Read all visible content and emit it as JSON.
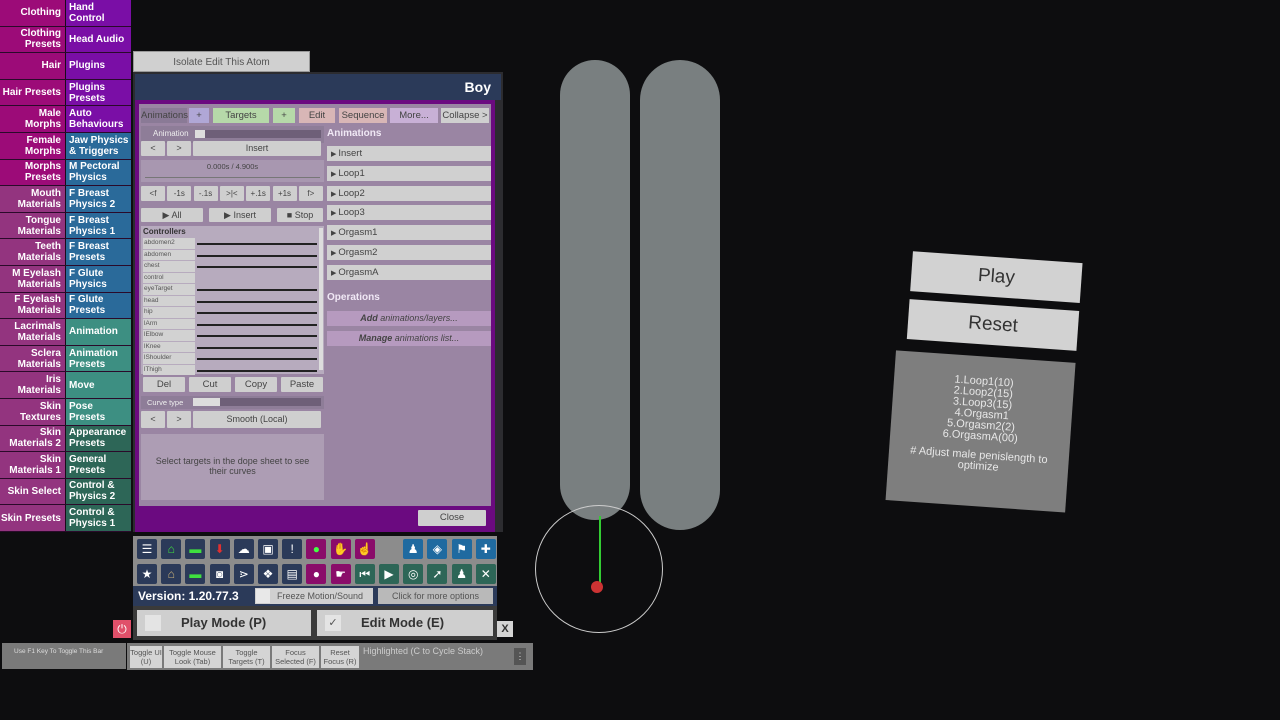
{
  "left_menu": [
    {
      "left": "Clothing",
      "right": "Hand Control",
      "lcolor": "#9c0b78",
      "rcolor": "#7a0ea6"
    },
    {
      "left": "Clothing Presets",
      "right": "Head Audio",
      "lcolor": "#9c0b78",
      "rcolor": "#7a0ea6"
    },
    {
      "left": "Hair",
      "right": "Plugins",
      "lcolor": "#9c0b78",
      "rcolor": "#7a0ea6"
    },
    {
      "left": "Hair Presets",
      "right": "Plugins Presets",
      "lcolor": "#9c0b78",
      "rcolor": "#7a0ea6"
    },
    {
      "left": "Male Morphs",
      "right": "Auto Behaviours",
      "lcolor": "#9c0b78",
      "rcolor": "#7a0ea6"
    },
    {
      "left": "Female Morphs",
      "right": "Jaw Physics & Triggers",
      "lcolor": "#9c0b78",
      "rcolor": "#2a6a9a"
    },
    {
      "left": "Morphs Presets",
      "right": "M Pectoral Physics",
      "lcolor": "#9c0b78",
      "rcolor": "#2a6a9a"
    },
    {
      "left": "Mouth Materials",
      "right": "F Breast Physics 2",
      "lcolor": "#93347f",
      "rcolor": "#2a6a9a"
    },
    {
      "left": "Tongue Materials",
      "right": "F Breast Physics 1",
      "lcolor": "#93347f",
      "rcolor": "#2a6a9a"
    },
    {
      "left": "Teeth Materials",
      "right": "F Breast Presets",
      "lcolor": "#93347f",
      "rcolor": "#2a6a9a"
    },
    {
      "left": "M Eyelash Materials",
      "right": "F Glute Physics",
      "lcolor": "#93347f",
      "rcolor": "#2a6a9a"
    },
    {
      "left": "F Eyelash Materials",
      "right": "F Glute Presets",
      "lcolor": "#93347f",
      "rcolor": "#2a6a9a"
    },
    {
      "left": "Lacrimals Materials",
      "right": "Animation",
      "lcolor": "#93347f",
      "rcolor": "#3d8f82"
    },
    {
      "left": "Sclera Materials",
      "right": "Animation Presets",
      "lcolor": "#93347f",
      "rcolor": "#3d8f82"
    },
    {
      "left": "Iris Materials",
      "right": "Move",
      "lcolor": "#93347f",
      "rcolor": "#3d8f82"
    },
    {
      "left": "Skin Textures",
      "right": "Pose Presets",
      "lcolor": "#93347f",
      "rcolor": "#3d8f82"
    },
    {
      "left": "Skin Materials 2",
      "right": "Appearance Presets",
      "lcolor": "#93347f",
      "rcolor": "#2d6657"
    },
    {
      "left": "Skin Materials 1",
      "right": "General Presets",
      "lcolor": "#93347f",
      "rcolor": "#2d6657"
    },
    {
      "left": "Skin Select",
      "right": "Control & Physics 2",
      "lcolor": "#93347f",
      "rcolor": "#2d6657"
    },
    {
      "left": "Skin Presets",
      "right": "Control & Physics 1",
      "lcolor": "#93347f",
      "rcolor": "#2d6657"
    }
  ],
  "isolate_button": "Isolate Edit This Atom",
  "panel": {
    "title": "Boy",
    "tabs": [
      {
        "label": "Animations",
        "color": "#8a7a96"
      },
      {
        "label": "+",
        "color": "#b0a7d6"
      },
      {
        "label": "Targets",
        "color": "#b6d9a9"
      },
      {
        "label": "+",
        "color": "#b6d9a9"
      },
      {
        "label": "Edit",
        "color": "#d8b6b6"
      },
      {
        "label": "Sequence",
        "color": "#d8b6b6"
      },
      {
        "label": "More...",
        "color": "#c8b0d6"
      },
      {
        "label": "Collapse >",
        "color": "#cfcfcf"
      }
    ],
    "animation_label": "Animation",
    "prev_btn": "<",
    "next_btn": ">",
    "insert_btn": "Insert",
    "time_display": "0.000s / 4.900s",
    "scrub_buttons": [
      "<f",
      "-1s",
      "-.1s",
      ">|<",
      "+.1s",
      "+1s",
      "f>"
    ],
    "play_all": "▶ All",
    "play_insert": "▶ Insert",
    "stop": "■ Stop",
    "controllers_header": "Controllers",
    "controllers": [
      "abdomen2",
      "abdomen",
      "chest",
      "control",
      "eyeTarget",
      "head",
      "hip",
      "lArm",
      "lElbow",
      "lKnee",
      "lShoulder",
      "lThigh"
    ],
    "edit_buttons": [
      "Del",
      "Cut",
      "Copy",
      "Paste"
    ],
    "curve_type_label": "Curve type",
    "curve_type_value": "Smooth (Local)",
    "curve_hint": "Select targets in the dope sheet to see their curves",
    "animations_header": "Animations",
    "animations": [
      "Insert",
      "Loop1",
      "Loop2",
      "Loop3",
      "Orgasm1",
      "Orgasm2",
      "OrgasmA"
    ],
    "operations_header": "Operations",
    "op_add": {
      "bold": "Add",
      "rest": " animations/layers..."
    },
    "op_manage": {
      "bold": "Manage",
      "rest": " animations list..."
    },
    "close_btn": "Close"
  },
  "toolbar": {
    "row1": [
      {
        "name": "menu-icon",
        "glyph": "☰",
        "color": "#2b3a59",
        "fg": "#fff"
      },
      {
        "name": "open-scene-icon",
        "glyph": "⌂",
        "color": "#2b3a59",
        "fg": "#3fe03f"
      },
      {
        "name": "folder-icon",
        "glyph": "▬",
        "color": "#2b3a59",
        "fg": "#3fe03f"
      },
      {
        "name": "save-icon",
        "glyph": "⬇",
        "color": "#2b3a59",
        "fg": "#e03030"
      },
      {
        "name": "cloud-icon",
        "glyph": "☁",
        "color": "#2b3a59",
        "fg": "#fff"
      },
      {
        "name": "package-icon",
        "glyph": "▣",
        "color": "#2b3a59",
        "fg": "#fff"
      },
      {
        "name": "alert-icon",
        "glyph": "!",
        "color": "#2b3a59",
        "fg": "#fff"
      },
      {
        "name": "add-person-icon",
        "glyph": "●",
        "color": "#8a0c6a",
        "fg": "#4f4"
      },
      {
        "name": "hand-icon",
        "glyph": "✋",
        "color": "#8a0c6a",
        "fg": "#fff"
      },
      {
        "name": "pointer-hand-icon",
        "glyph": "☝",
        "color": "#8a0c6a",
        "fg": "#fff"
      },
      {
        "name": "person-icon",
        "glyph": "♟",
        "color": "#1f6aa0",
        "fg": "#fff"
      },
      {
        "name": "unity-icon",
        "glyph": "◈",
        "color": "#1f6aa0",
        "fg": "#fff"
      },
      {
        "name": "flag-icon",
        "glyph": "⚑",
        "color": "#1f6aa0",
        "fg": "#fff"
      },
      {
        "name": "plus-icon",
        "glyph": "✚",
        "color": "#1f6aa0",
        "fg": "#fff"
      }
    ],
    "row2": [
      {
        "name": "star-icon",
        "glyph": "★",
        "color": "#2b3a59",
        "fg": "#fff"
      },
      {
        "name": "open-scene-alt-icon",
        "glyph": "⌂",
        "color": "#2b3a59",
        "fg": "#cdb37a"
      },
      {
        "name": "folder-add-icon",
        "glyph": "▬",
        "color": "#2b3a59",
        "fg": "#3fe03f"
      },
      {
        "name": "camera-icon",
        "glyph": "◙",
        "color": "#2b3a59",
        "fg": "#fff"
      },
      {
        "name": "share-icon",
        "glyph": "⋗",
        "color": "#2b3a59",
        "fg": "#fff"
      },
      {
        "name": "package-open-icon",
        "glyph": "❖",
        "color": "#2b3a59",
        "fg": "#fff"
      },
      {
        "name": "document-icon",
        "glyph": "▤",
        "color": "#2b3a59",
        "fg": "#fff"
      },
      {
        "name": "remove-person-icon",
        "glyph": "●",
        "color": "#8a0c6a",
        "fg": "#fff"
      },
      {
        "name": "grab-hand-icon",
        "glyph": "☛",
        "color": "#8a0c6a",
        "fg": "#fff"
      },
      {
        "name": "skip-back-icon",
        "glyph": "⏮",
        "color": "#2d6657",
        "fg": "#fff"
      },
      {
        "name": "play-icon",
        "glyph": "▶",
        "color": "#2d6657",
        "fg": "#fff"
      },
      {
        "name": "target-icon",
        "glyph": "◎",
        "color": "#2d6657",
        "fg": "#fff"
      },
      {
        "name": "cursor-icon",
        "glyph": "➚",
        "color": "#2d6657",
        "fg": "#fff"
      },
      {
        "name": "people-icon",
        "glyph": "♟",
        "color": "#2d6657",
        "fg": "#fff"
      },
      {
        "name": "tools-icon",
        "glyph": "✕",
        "color": "#2d6657",
        "fg": "#fff"
      }
    ]
  },
  "version": "Version: 1.20.77.3",
  "freeze_motion": "Freeze Motion/Sound",
  "more_options": "Click for more options",
  "play_mode": "Play Mode (P)",
  "edit_mode": "Edit Mode (E)",
  "edit_mode_checked": "✓",
  "power_glyph": "⏻",
  "close_x": "X",
  "hint": "Use F1 Key To Toggle This Bar",
  "bottom_buttons": [
    "Toggle UI (U)",
    "Toggle Mouse Look (Tab)",
    "Toggle Targets (T)",
    "Focus Selected (F)",
    "Reset Focus (R)"
  ],
  "highlighted_label": "Highlighted (C to Cycle Stack)",
  "dots_glyph": "⋮",
  "world_ui": {
    "play": "Play",
    "reset": "Reset",
    "lines": [
      "1.Loop1(10)",
      "2.Loop2(15)",
      "3.Loop3(15)",
      "4.Orgasm1",
      "5.Orgasm2(2)",
      "6.OrgasmA(00)"
    ],
    "note": "# Adjust male penislength to optimize"
  }
}
